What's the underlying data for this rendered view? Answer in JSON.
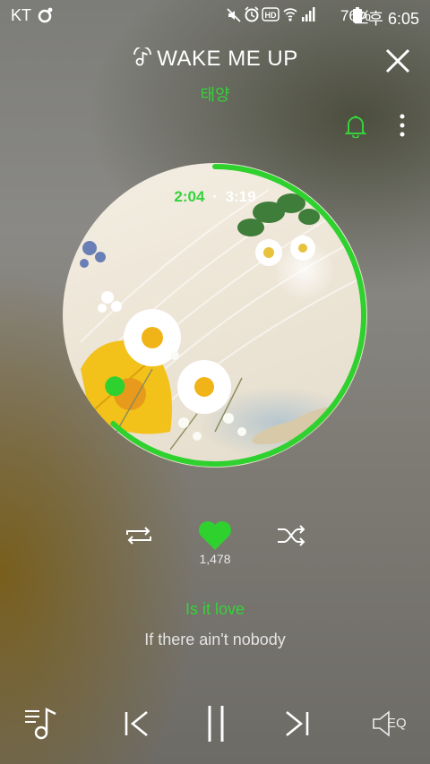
{
  "status_bar": {
    "carrier": "KT",
    "battery": "76%",
    "period": "오후",
    "time": "6:05",
    "icons": [
      "music-app-icon",
      "mute-icon",
      "alarm-icon",
      "hd-voice-icon",
      "wifi-icon",
      "signal-icon",
      "battery-icon"
    ]
  },
  "header": {
    "title": "WAKE ME UP",
    "artist": "태양"
  },
  "player": {
    "elapsed": "2:04",
    "separator": "·",
    "duration": "3:19",
    "progress_fraction": 0.62,
    "like_count": "1,478",
    "accent_color": "#2fd12f"
  },
  "lyrics": {
    "current": "Is it love",
    "next": "If there ain't nobody"
  },
  "bottom_bar": {
    "eq_label": "EQ"
  }
}
